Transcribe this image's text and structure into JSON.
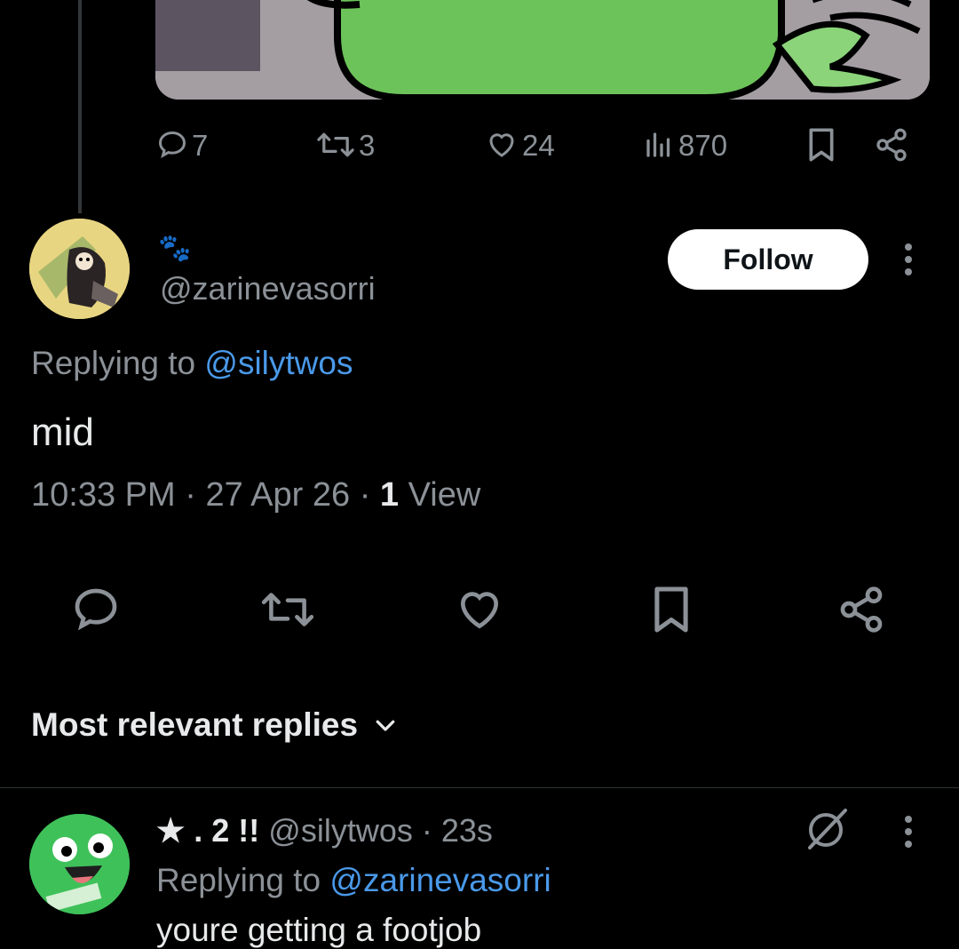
{
  "parent_post": {
    "stats": {
      "replies": "7",
      "reposts": "3",
      "likes": "24",
      "views": "870"
    }
  },
  "reply_post": {
    "display_name_emoji": "🐾",
    "handle": "@zarinevasorri",
    "follow_label": "Follow",
    "replying_prefix": "Replying to ",
    "replying_to": "@silytwos",
    "text": "mid",
    "time": "10:33 PM",
    "date": "27 Apr 26",
    "view_count": "1",
    "view_label": "View",
    "separator": "·"
  },
  "replies_section": {
    "sort_label": "Most relevant replies"
  },
  "replies": [
    {
      "display_name": "★ . 2 !!",
      "handle": "@silytwos",
      "age": "23s",
      "replying_prefix": "Replying to ",
      "replying_to": "@zarinevasorri",
      "text": "youre getting a footjob"
    }
  ],
  "colors": {
    "background": "#000000",
    "text": "#e7e9ea",
    "muted": "#8b9197",
    "link": "#4a99e9",
    "media_green": "#6cc35a"
  },
  "icons": [
    "comment-icon",
    "repost-icon",
    "heart-icon",
    "views-icon",
    "bookmark-icon",
    "share-icon",
    "more-icon",
    "chevron-down-icon",
    "grok-icon"
  ]
}
